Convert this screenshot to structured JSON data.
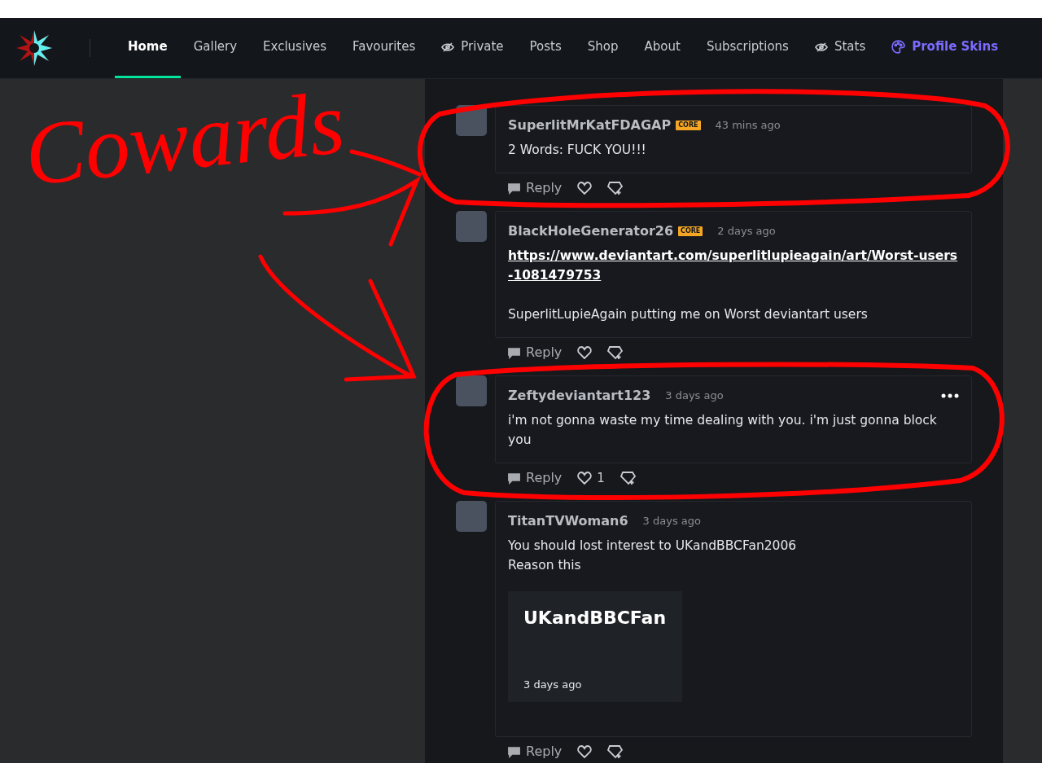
{
  "nav": {
    "tabs": [
      {
        "label": "Home",
        "kind": "plain",
        "selected": true
      },
      {
        "label": "Gallery",
        "kind": "plain",
        "selected": false
      },
      {
        "label": "Exclusives",
        "kind": "plain",
        "selected": false
      },
      {
        "label": "Favourites",
        "kind": "plain",
        "selected": false
      },
      {
        "label": "Private",
        "kind": "hidden",
        "selected": false
      },
      {
        "label": "Posts",
        "kind": "plain",
        "selected": false
      },
      {
        "label": "Shop",
        "kind": "plain",
        "selected": false
      },
      {
        "label": "About",
        "kind": "plain",
        "selected": false
      },
      {
        "label": "Subscriptions",
        "kind": "plain",
        "selected": false
      },
      {
        "label": "Stats",
        "kind": "hidden",
        "selected": false
      },
      {
        "label": "Profile Skins",
        "kind": "promo",
        "selected": false
      }
    ]
  },
  "comments": [
    {
      "user": "SuperlitMrKatFDAGAP",
      "badge": "CORE",
      "time": "43 mins ago",
      "menu": false,
      "body": [
        {
          "kind": "text",
          "lines": [
            "2 Words: FUCK YOU!!!"
          ]
        }
      ],
      "reply": "Reply"
    },
    {
      "user": "BlackHoleGenerator26",
      "badge": "CORE",
      "time": "2 days ago",
      "menu": false,
      "body": [
        {
          "kind": "link",
          "lines": [
            "https://www.deviantart.com/superlitlupieagain/art/Worst-users-1081479753"
          ]
        },
        {
          "kind": "text",
          "lines": [
            "SuperlitLupieAgain putting me on Worst deviantart users"
          ]
        }
      ],
      "reply": "Reply"
    },
    {
      "user": "Zeftydeviantart123",
      "time": "3 days ago",
      "menu": true,
      "body": [
        {
          "kind": "text",
          "lines": [
            "i'm not gonna waste my time dealing with you. i'm just gonna block you"
          ]
        }
      ],
      "reply": "Reply",
      "likes": "1"
    },
    {
      "user": "TitanTVWoman6",
      "time": "3 days ago",
      "menu": false,
      "body": [
        {
          "kind": "text",
          "lines": [
            "You should lost interest to UKandBBCFan2006",
            "Reason this"
          ]
        }
      ],
      "preview": {
        "title": "UKandBBCFan",
        "time": "3 days ago"
      },
      "reply": "Reply"
    }
  ],
  "annotation": {
    "text": "Cowards"
  }
}
